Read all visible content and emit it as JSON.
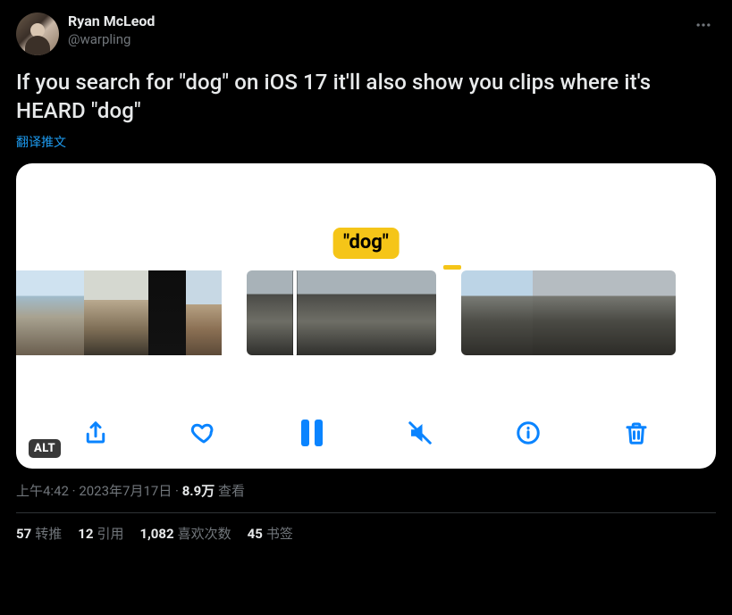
{
  "author": {
    "display_name": "Ryan McLeod",
    "handle": "@warpling"
  },
  "body_text": "If you search for \"dog\" on iOS 17 it'll also show you clips where it's HEARD \"dog\"",
  "translate_label": "翻译推文",
  "media": {
    "caption_token": "\"dog\"",
    "alt_badge": "ALT"
  },
  "meta": {
    "time": "上午4:42",
    "date": "2023年7月17日",
    "views_number": "8.9万",
    "views_label": "查看",
    "separator": " · "
  },
  "stats": {
    "retweets": {
      "count": "57",
      "label": "转推"
    },
    "quotes": {
      "count": "12",
      "label": "引用"
    },
    "likes": {
      "count": "1,082",
      "label": "喜欢次数"
    },
    "bookmarks": {
      "count": "45",
      "label": "书签"
    }
  }
}
